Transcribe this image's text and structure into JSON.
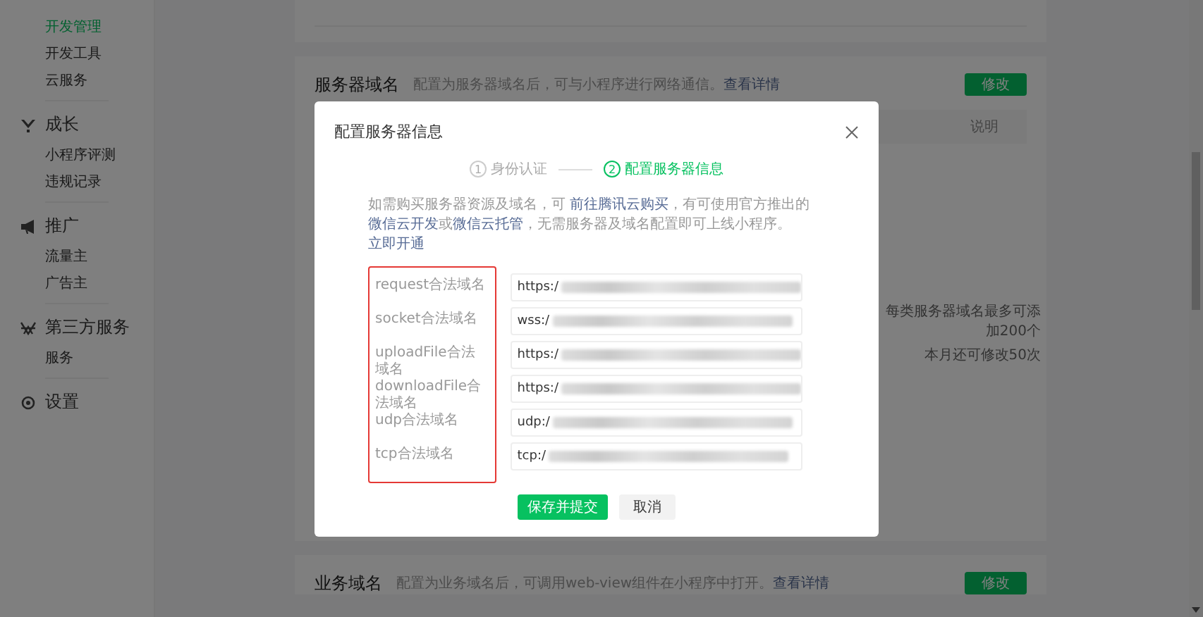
{
  "sidebar": {
    "groups": [
      {
        "items": [
          {
            "label": "开发管理",
            "selected": true
          },
          {
            "label": "开发工具",
            "selected": false
          },
          {
            "label": "云服务",
            "selected": false
          }
        ]
      },
      {
        "title": "成长",
        "kind": "growth",
        "items": [
          {
            "label": "小程序评测",
            "selected": false
          },
          {
            "label": "违规记录",
            "selected": false
          }
        ]
      },
      {
        "title": "推广",
        "kind": "promote",
        "items": [
          {
            "label": "流量主",
            "selected": false
          },
          {
            "label": "广告主",
            "selected": false
          }
        ]
      },
      {
        "title": "第三方服务",
        "kind": "thirdparty",
        "items": [
          {
            "label": "服务",
            "selected": false
          }
        ]
      },
      {
        "title": "设置",
        "kind": "settings"
      }
    ]
  },
  "sections": [
    {
      "title": "服务器域名",
      "description": "配置为服务器域名后，可与小程序进行网络通信。",
      "link": "查看详情",
      "button": "修改",
      "table_header": "说明",
      "notes": [
        "每类服务器域名最多可添加200个",
        "本月还可修改50次"
      ]
    },
    {
      "title": "业务域名",
      "description": "配置为业务域名后，可调用web-view组件在小程序中打开。",
      "link": "查看详情",
      "button": "修改"
    }
  ],
  "modal": {
    "title": "配置服务器信息",
    "steps": [
      {
        "number": "1",
        "label": "身份认证",
        "selected": false
      },
      {
        "number": "2",
        "label": "配置服务器信息",
        "selected": true
      }
    ],
    "note": [
      {
        "text": "如需购买服务器资源及域名，可 ",
        "link": false
      },
      {
        "text": "前往腾讯云购买",
        "link": true
      },
      {
        "text": "，有可使用官方推出的 ",
        "link": false
      },
      {
        "text": "微信云开发",
        "link": true
      },
      {
        "text": "或",
        "link": false
      },
      {
        "text": "微信云托管",
        "link": true
      },
      {
        "text": "，无需服务器及域名配置即可上线小程序。",
        "link": false
      },
      {
        "text": "立即开通",
        "link": true
      }
    ],
    "labels_highlighted": true,
    "fields": [
      {
        "label": "request合法域名",
        "value": "https:/",
        "redacted": true
      },
      {
        "label": "socket合法域名",
        "value": "wss:/",
        "redacted": true
      },
      {
        "label": "uploadFile合法域名",
        "value": "https:/",
        "redacted": true
      },
      {
        "label": "downloadFile合法域名",
        "value": "https:/",
        "redacted": true
      },
      {
        "label": "udp合法域名",
        "value": "udp:/",
        "redacted": true
      },
      {
        "label": "tcp合法域名",
        "value": "tcp:/",
        "redacted": true
      }
    ],
    "buttons": [
      {
        "label": "保存并提交",
        "kind": "primary"
      },
      {
        "label": "取消",
        "kind": "default"
      }
    ]
  }
}
